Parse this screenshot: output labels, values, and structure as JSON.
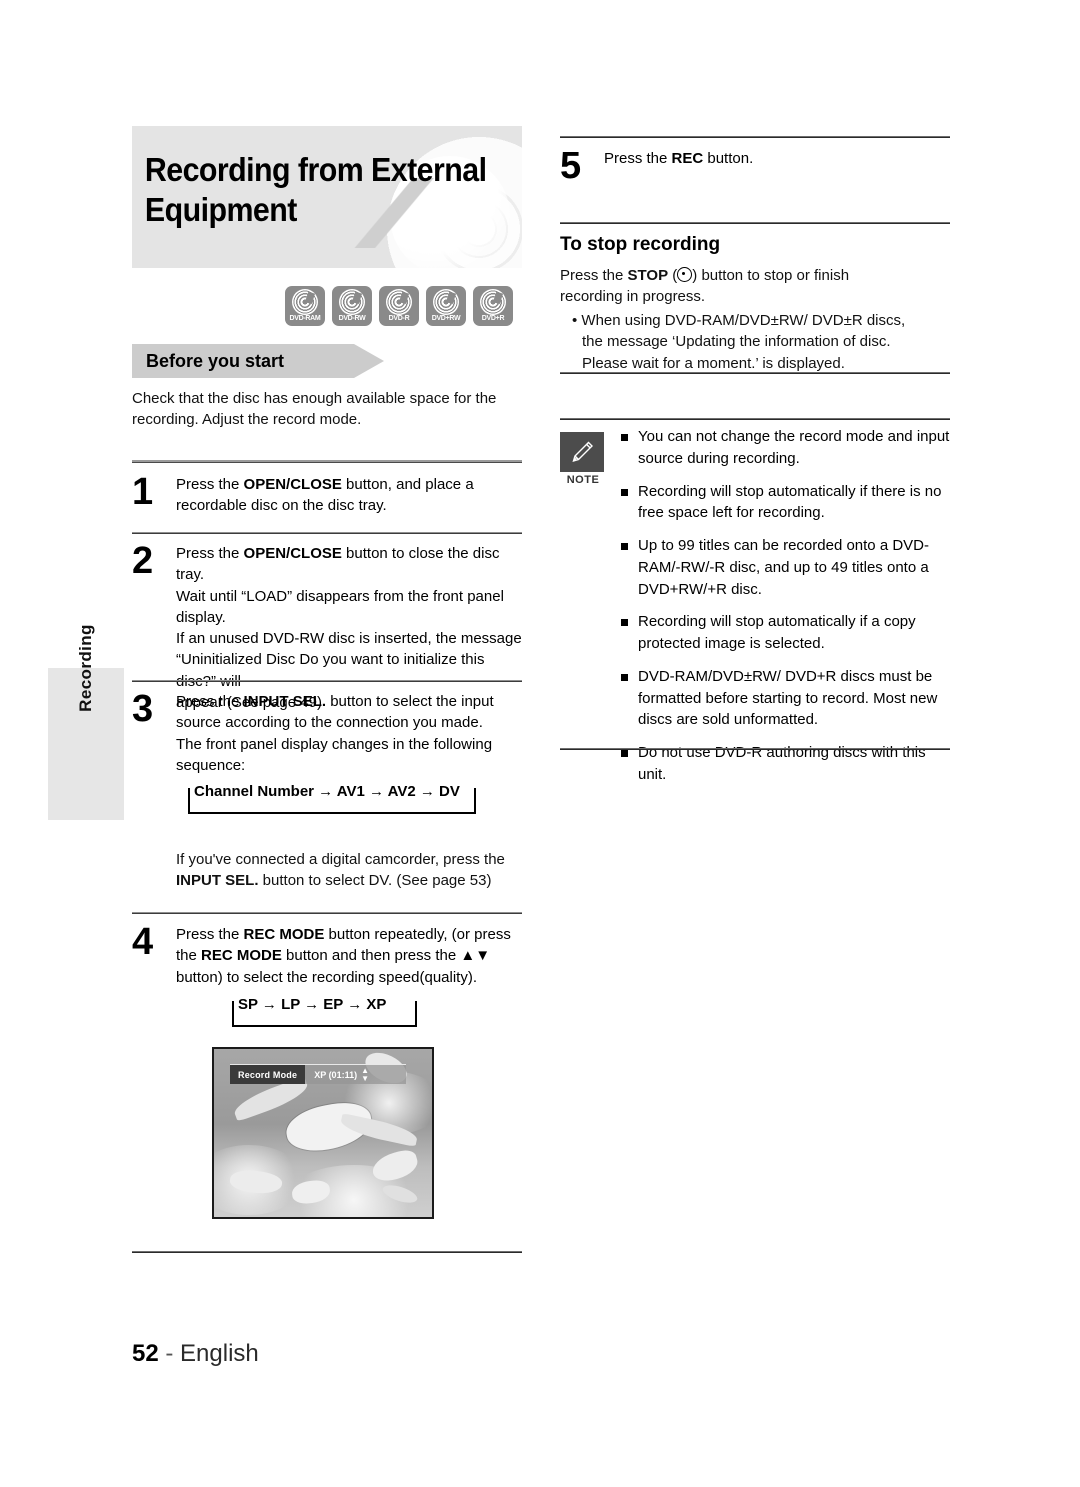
{
  "page": {
    "side_tab_label": "Recording",
    "footer_page_number": "52",
    "footer_separator": "-",
    "footer_language": "English"
  },
  "header": {
    "title_line1": "Recording from External",
    "title_line2": "Equipment",
    "disc_logos": [
      "DVD-RAM",
      "DVD-RW",
      "DVD-R",
      "DVD+RW",
      "DVD+R"
    ]
  },
  "before_you_start": {
    "banner_label": "Before you start",
    "text": "Check that the disc has enough available space for the recording. Adjust the record mode."
  },
  "steps": [
    {
      "number": "1",
      "lines": [
        "Press the OPEN/CLOSE button, and place a",
        "recordable disc on the disc tray."
      ],
      "bold_terms": [
        "OPEN/CLOSE"
      ]
    },
    {
      "number": "2",
      "lines": [
        "Press the OPEN/CLOSE button to close the disc tray.",
        "Wait until “LOAD” disappears from the front panel",
        "display.",
        "If an unused DVD-RW disc is inserted, the message",
        "“Uninitialized Disc Do you want to initialize this disc?” will",
        "appear (See page 49)"
      ],
      "bold_terms": [
        "OPEN/CLOSE"
      ]
    },
    {
      "number": "3",
      "lines": [
        "Press the INPUT SEL. button to select the input",
        "source according to the connection you made.",
        "The front panel display changes in the following",
        "sequence:"
      ],
      "bold_terms": [
        "INPUT SEL."
      ],
      "sequence": "Channel Number → AV1 → AV2 → DV",
      "after_lines": [
        "If you've connected a digital camcorder, press the",
        "INPUT SEL. button to select DV. (See page 53)"
      ]
    },
    {
      "number": "4",
      "lines": [
        "Press the REC MODE button repeatedly, (or press",
        "the REC MODE button and then press the ▲▼",
        "button) to select the recording speed(quality)."
      ],
      "bold_terms": [
        "REC MODE"
      ],
      "sequence": "SP → LP → EP → XP"
    },
    {
      "number": "5",
      "lines": [
        "Press the REC button."
      ],
      "bold_terms": [
        "REC"
      ]
    }
  ],
  "tv_screenshot": {
    "osd_label": "Record Mode",
    "osd_value": "XP (01:11)",
    "osd_updown_icon": "up-down-arrow-icon"
  },
  "to_stop_recording": {
    "heading": "To stop recording",
    "paragraph_lines": [
      "Press the STOP (⊙) button to stop or finish",
      "recording in progress."
    ],
    "bullet_lines": [
      "• When using DVD-RAM/DVD±RW/ DVD±R discs,",
      "the message ‘Updating the information of disc.",
      "Please wait for a moment.’ is displayed."
    ]
  },
  "note": {
    "icon_name": "pencil-icon",
    "caption": "NOTE",
    "items": [
      "You can not change the record mode and input source during recording.",
      "Recording will stop automatically if there is no free space left for recording.",
      "Up to 99 titles can be recorded onto a DVD-RAM/-RW/-R disc, and up to 49 titles onto a DVD+RW/+R disc.",
      "Recording will stop automatically if a copy protected image is selected.",
      "DVD-RAM/DVD±RW/ DVD+R discs must be formatted before starting to record. Most new discs are sold unformatted.",
      "Do not use DVD-R authoring discs with this unit."
    ]
  },
  "colors": {
    "banner_bg": "#e4e4e4",
    "section_banner_bg": "#cccccc",
    "disc_logo_bg": "#8a8a8a",
    "note_icon_bg": "#4c4c4c",
    "side_tab_bg": "#e6e6e6",
    "rule": "#8f8f8f"
  }
}
